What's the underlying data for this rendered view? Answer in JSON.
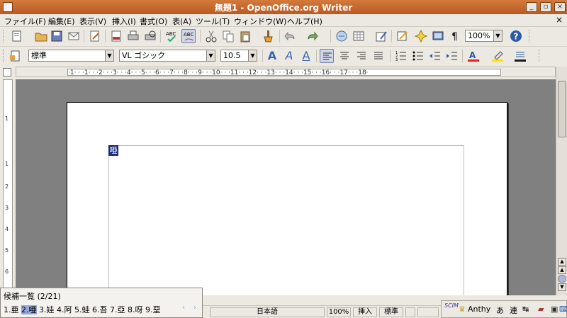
{
  "window": {
    "title": "無題1 - OpenOffice.org Writer",
    "minimize": "_",
    "maximize": "▫",
    "close": "×"
  },
  "menu": {
    "items": [
      "ファイル(F)",
      "編集(E)",
      "表示(V)",
      "挿入(I)",
      "書式(O)",
      "表(A)",
      "ツール(T)",
      "ウィンドウ(W)",
      "ヘルプ(H)"
    ],
    "close_glyph": "×"
  },
  "toolbar1": {
    "zoom_value": "100%"
  },
  "toolbar2": {
    "style_value": "標準",
    "font_value": "VL ゴシック",
    "size_value": "10.5",
    "a_glyph": "A"
  },
  "ruler": {
    "h_text": "·1·  ·  ·1·  ·  ·2·  ·  ·3·  ·  ·4·  ·  ·5·  ·  ·6·  ·  ·7·  ·  ·8·  ·  ·9·  ·  ·10·  ·  ·11·  ·  ·12·  ·  ·13·  ·  ·14·  ·  ·15·  ·  ·16·  ·  ·17·  ·  ·18·",
    "v_marks": [
      "1",
      "1",
      "2",
      "3",
      "4",
      "5",
      "6"
    ]
  },
  "document": {
    "composing_char": "唖"
  },
  "candidates": {
    "title": "候補一覧 (2/21)",
    "items": [
      {
        "label": "1.亜",
        "selected": false
      },
      {
        "label": "2.唖",
        "selected": true
      },
      {
        "label": "3.娃",
        "selected": false
      },
      {
        "label": "4.阿",
        "selected": false
      },
      {
        "label": "5.蛙",
        "selected": false
      },
      {
        "label": "6.吾",
        "selected": false
      },
      {
        "label": "7.亞",
        "selected": false
      },
      {
        "label": "8.呀",
        "selected": false
      },
      {
        "label": "9.堊",
        "selected": false
      }
    ],
    "prev": "‹",
    "next": "›"
  },
  "status": {
    "language": "日本語",
    "zoom": "100%",
    "mode": "挿入",
    "selection": "標準"
  },
  "ime": {
    "scim": "SCIM",
    "engine": "Anthy",
    "hiragana": "あ",
    "conv": "連"
  },
  "colors": {
    "titlebar": "#c96a2e",
    "highlight_bg": "#1e2a78",
    "candidate_sel": "#96a8d8"
  }
}
